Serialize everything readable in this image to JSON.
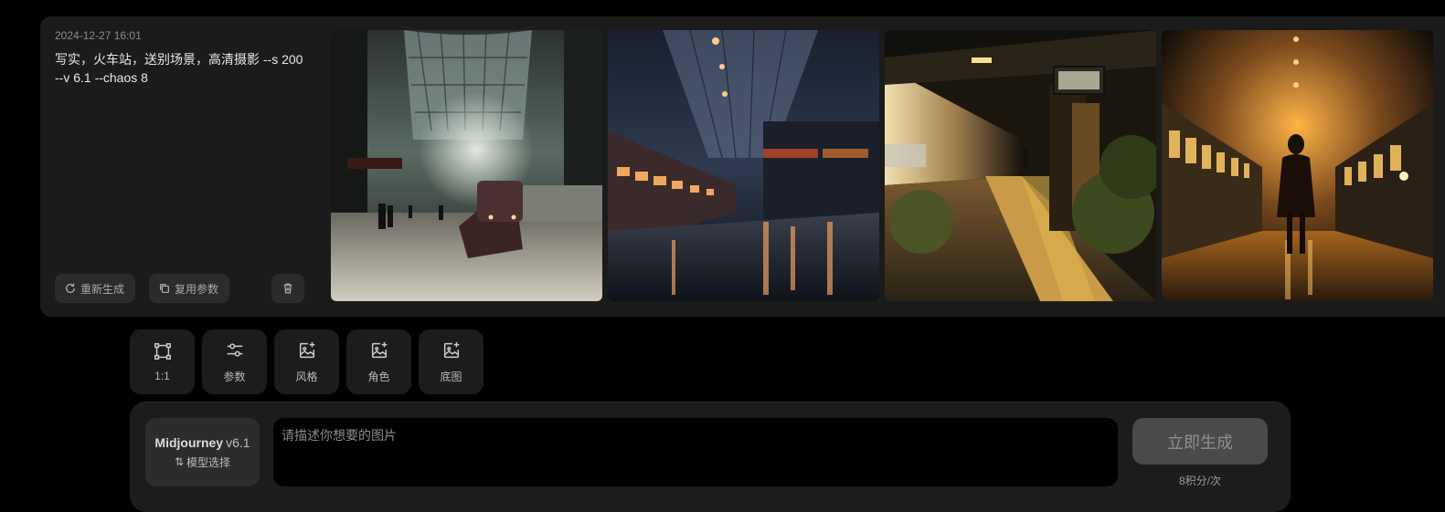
{
  "result": {
    "timestamp": "2024-12-27 16:01",
    "prompt": "写实，火车站，送别场景，高清摄影 --s 200 --v 6.1 --chaos 8",
    "actions": {
      "regenerate_label": "重新生成",
      "reuse_label": "复用参数"
    },
    "images": [
      {
        "name": "image-1",
        "scene": "steam-train-station-hall"
      },
      {
        "name": "image-2",
        "scene": "wet-platform-night-train"
      },
      {
        "name": "image-3",
        "scene": "sunset-platform-figure"
      },
      {
        "name": "image-4",
        "scene": "woman-on-glowing-platform"
      }
    ]
  },
  "tools": [
    {
      "label": "1:1",
      "icon": "aspect-ratio-icon"
    },
    {
      "label": "参数",
      "icon": "sliders-icon"
    },
    {
      "label": "风格",
      "icon": "image-plus-icon"
    },
    {
      "label": "角色",
      "icon": "image-plus-icon"
    },
    {
      "label": "底图",
      "icon": "image-plus-icon"
    }
  ],
  "composer": {
    "model_name": "Midjourney",
    "model_version": "v6.1",
    "model_switch_label": "模型选择",
    "placeholder": "请描述你想要的图片",
    "generate_label": "立即生成",
    "cost_label": "8积分/次"
  }
}
